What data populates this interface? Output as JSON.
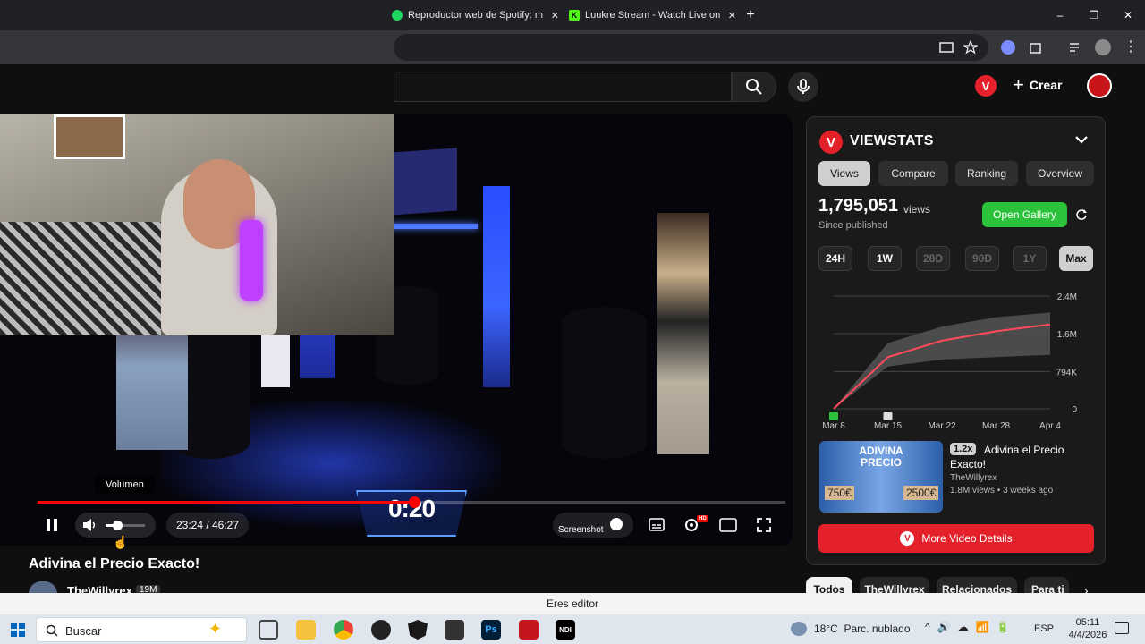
{
  "browser": {
    "tabs": [
      {
        "label": "Reproductor web de Spotify: m",
        "icon": "spotify-icon",
        "color": "#1ed760"
      },
      {
        "label": "Luukre Stream - Watch Live on",
        "icon": "kick-icon",
        "color": "#53fc18"
      }
    ],
    "new_tab": "+",
    "window_controls": [
      "–",
      "❐",
      "✕"
    ]
  },
  "youtube": {
    "header": {
      "create_label": "Crear",
      "notification_badge": "V"
    },
    "player": {
      "time_display": "23:24 / 46:27",
      "progress_fraction": 0.503,
      "volume_fraction": 0.3,
      "tooltip": "Volumen",
      "overlay_timer": "0:20",
      "screenshot_label": "Screenshot",
      "quality_badge": "HD"
    },
    "video": {
      "title": "Adivina el Precio Exacto!",
      "channel": "TheWillyrex",
      "subscribers": "19M"
    },
    "chips": [
      "Todos",
      "TheWillyrex",
      "Relacionados",
      "Para ti"
    ]
  },
  "viewstats": {
    "brand": "VIEWSTATS",
    "logo_letter": "V",
    "tabs": [
      "Views",
      "Compare",
      "Ranking",
      "Overview"
    ],
    "active_tab": "Views",
    "views_count": "1,795,051",
    "views_unit": "views",
    "views_sub": "Since published",
    "open_gallery": "Open Gallery",
    "ranges": [
      "24H",
      "1W",
      "28D",
      "90D",
      "1Y",
      "Max"
    ],
    "active_range": "Max",
    "more_details": "More Video Details",
    "related": {
      "speed": "1.2x",
      "title": "Adivina el Precio Exacto!",
      "channel": "TheWillyrex",
      "meta": "1.8M views • 3 weeks ago",
      "thumb_text": [
        "ADIVINA",
        "PRECIO"
      ],
      "prices": [
        "750€",
        "2500€"
      ]
    },
    "accent": "#e4202a",
    "green": "#2bc13b"
  },
  "chart_data": {
    "type": "line",
    "x": [
      "Mar 8",
      "Mar 15",
      "Mar 22",
      "Mar 28",
      "Apr 4"
    ],
    "y_ticks": [
      "0",
      "794K",
      "1.6M",
      "2.4M"
    ],
    "ylim": [
      0,
      2400000
    ],
    "series": [
      {
        "values": [
          0,
          1100000,
          1450000,
          1650000,
          1795051
        ]
      }
    ],
    "band_upper": [
      0,
      1400000,
      1750000,
      1950000,
      2050000
    ],
    "band_lower": [
      0,
      900000,
      1050000,
      1100000,
      1150000
    ]
  },
  "taskbar": {
    "search_placeholder": "Buscar",
    "weather": "18°C  Parc. nublado",
    "lang": "ESP",
    "time": "05:11",
    "date": "4/4/2026"
  },
  "editor_bar": "Eres editor"
}
